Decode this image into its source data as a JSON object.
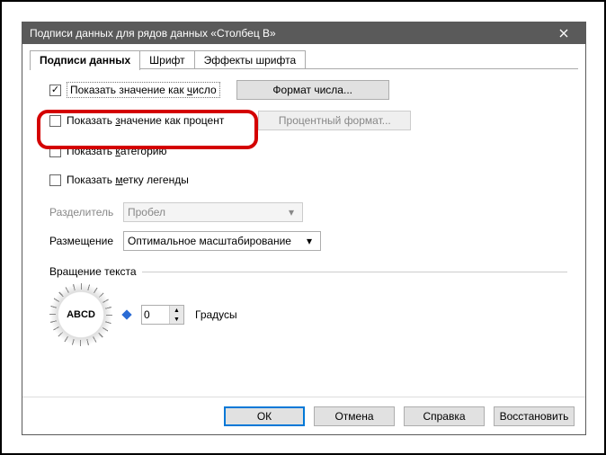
{
  "window": {
    "title": "Подписи данных для рядов данных «Столбец B»"
  },
  "tabs": {
    "data_labels": "Подписи данных",
    "font": "Шрифт",
    "font_effects": "Эффекты шрифта"
  },
  "options": {
    "show_as_number_pre": "Показать значение как ",
    "show_as_number_ul": "ч",
    "show_as_number_post": "исло",
    "show_as_percent_pre": "Показать ",
    "show_as_percent_ul": "з",
    "show_as_percent_post": "начение как процент",
    "show_category_pre": "Показать ",
    "show_category_ul": "к",
    "show_category_post": "атегорию",
    "show_legend_pre": "Показать ",
    "show_legend_ul": "м",
    "show_legend_post": "етку легенды"
  },
  "buttons": {
    "number_format_ul": "Ф",
    "number_format_post": "ормат числа...",
    "percent_format": "Процентный формат..."
  },
  "separator": {
    "label_pre": "Р",
    "label_ul": "а",
    "label_post": "зделитель",
    "value": "Пробел"
  },
  "placement": {
    "label": "Размещение",
    "value": "Оптимальное масштабирование"
  },
  "rotation": {
    "fieldset": "Вращение текста",
    "dial_text": "ABCD",
    "degrees_value": "0",
    "degrees_label": "Градусы"
  },
  "footer": {
    "ok": "ОК",
    "cancel": "Отмена",
    "help_ul": "С",
    "help_post": "правка",
    "reset_ul": "В",
    "reset_post": "осстановить"
  }
}
